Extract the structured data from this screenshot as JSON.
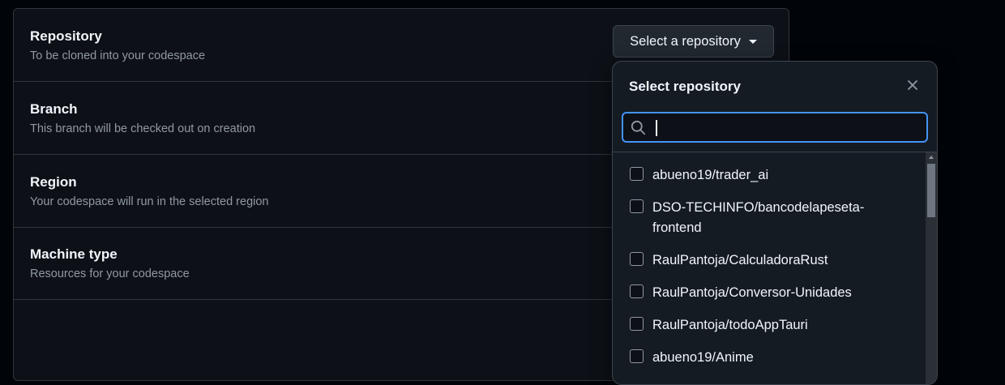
{
  "settings": {
    "rows": [
      {
        "title": "Repository",
        "description": "To be cloned into your codespace"
      },
      {
        "title": "Branch",
        "description": "This branch will be checked out on creation"
      },
      {
        "title": "Region",
        "description": "Your codespace will run in the selected region"
      },
      {
        "title": "Machine type",
        "description": "Resources for your codespace"
      }
    ]
  },
  "repository_button": {
    "label": "Select a repository",
    "icon": "caret-down-icon"
  },
  "repo_panel": {
    "title": "Select repository",
    "close_icon": "close-icon",
    "search": {
      "value": "",
      "placeholder": "",
      "icon": "search-icon"
    },
    "items": [
      "abueno19/trader_ai",
      "DSO-TECHINFO/bancodelapeseta-frontend",
      "RaulPantoja/CalculadoraRust",
      "RaulPantoja/Conversor-Unidades",
      "RaulPantoja/todoAppTauri",
      "abueno19/Anime"
    ]
  },
  "colors": {
    "page_background": "#010409",
    "card_background": "#0d1117",
    "border": "#30363d",
    "text_primary": "#f0f6fc",
    "text_muted": "#9198a1",
    "focus_accent": "#4493f8"
  }
}
